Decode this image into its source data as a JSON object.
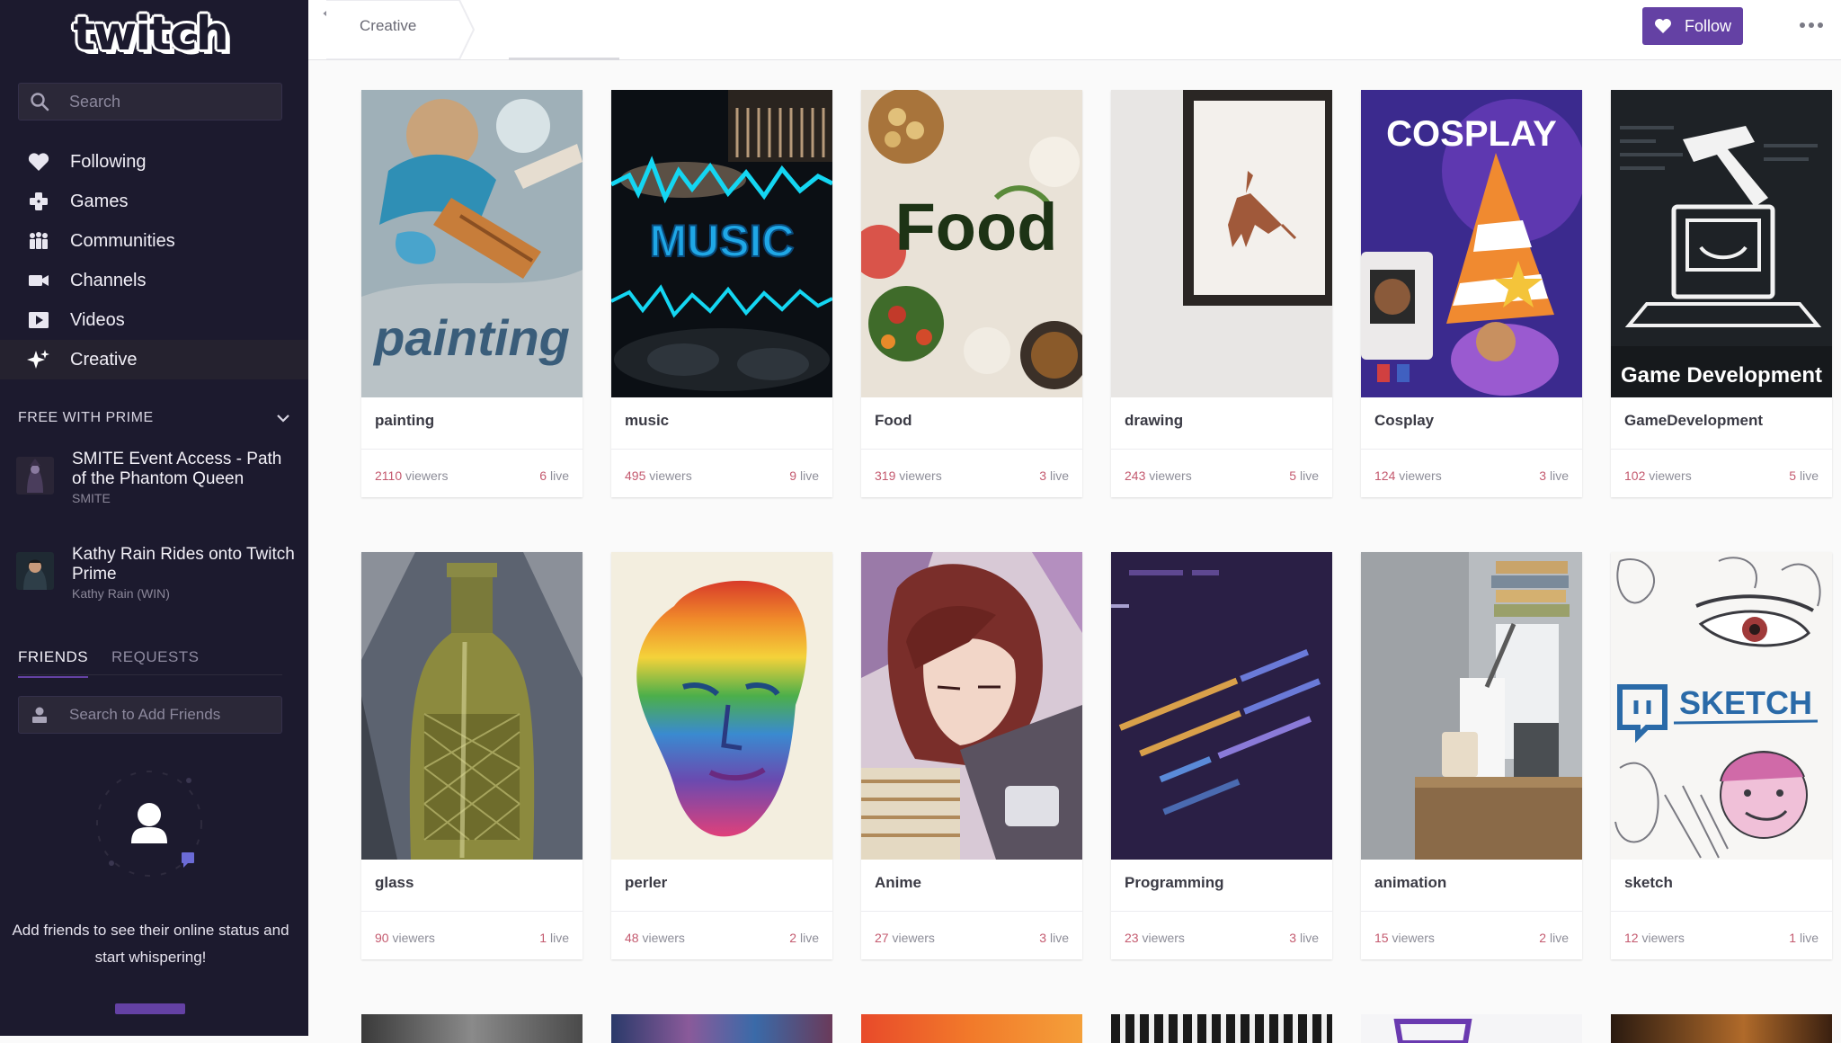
{
  "sidebar": {
    "logo": "twitch",
    "search": {
      "placeholder": "Search"
    },
    "nav": [
      {
        "label": "Following",
        "icon": "heart-icon"
      },
      {
        "label": "Games",
        "icon": "gamepad-icon"
      },
      {
        "label": "Communities",
        "icon": "people-icon"
      },
      {
        "label": "Channels",
        "icon": "camera-icon"
      },
      {
        "label": "Videos",
        "icon": "play-icon"
      },
      {
        "label": "Creative",
        "icon": "sparkle-icon"
      }
    ],
    "prime": {
      "header": "FREE WITH PRIME",
      "offers": [
        {
          "title": "SMITE Event Access - Path of the Phantom Queen",
          "subtitle": "SMITE"
        },
        {
          "title": "Kathy Rain Rides onto Twitch Prime",
          "subtitle": "Kathy Rain (WIN)"
        }
      ]
    },
    "friends": {
      "tabs": [
        "FRIENDS",
        "REQUESTS"
      ],
      "search_placeholder": "Search to Add Friends",
      "empty_text": "Add friends to see their online status and start whispering!"
    }
  },
  "topbar": {
    "breadcrumb": "Creative",
    "follow_label": "Follow"
  },
  "communities": [
    {
      "name": "painting",
      "viewers": "2110",
      "live": "6"
    },
    {
      "name": "music",
      "viewers": "495",
      "live": "9"
    },
    {
      "name": "Food",
      "viewers": "319",
      "live": "3"
    },
    {
      "name": "drawing",
      "viewers": "243",
      "live": "5"
    },
    {
      "name": "Cosplay",
      "viewers": "124",
      "live": "3"
    },
    {
      "name": "GameDevelopment",
      "viewers": "102",
      "live": "5"
    },
    {
      "name": "glass",
      "viewers": "90",
      "live": "1"
    },
    {
      "name": "perler",
      "viewers": "48",
      "live": "2"
    },
    {
      "name": "Anime",
      "viewers": "27",
      "live": "3"
    },
    {
      "name": "Programming",
      "viewers": "23",
      "live": "3"
    },
    {
      "name": "animation",
      "viewers": "15",
      "live": "2"
    },
    {
      "name": "sketch",
      "viewers": "12",
      "live": "1"
    }
  ],
  "labels": {
    "viewers_suffix": "viewers",
    "live_suffix": "live"
  },
  "art_text": {
    "painting": "painting",
    "music": "MUSIC",
    "food": "Food",
    "cosplay": "COSPLAY",
    "gamedev": "Game Development",
    "sketch": "SKETCH"
  },
  "colors": {
    "sidebar_bg": "#1c1a2e",
    "accent": "#6441a4",
    "viewer_count": "#c45a6f"
  }
}
